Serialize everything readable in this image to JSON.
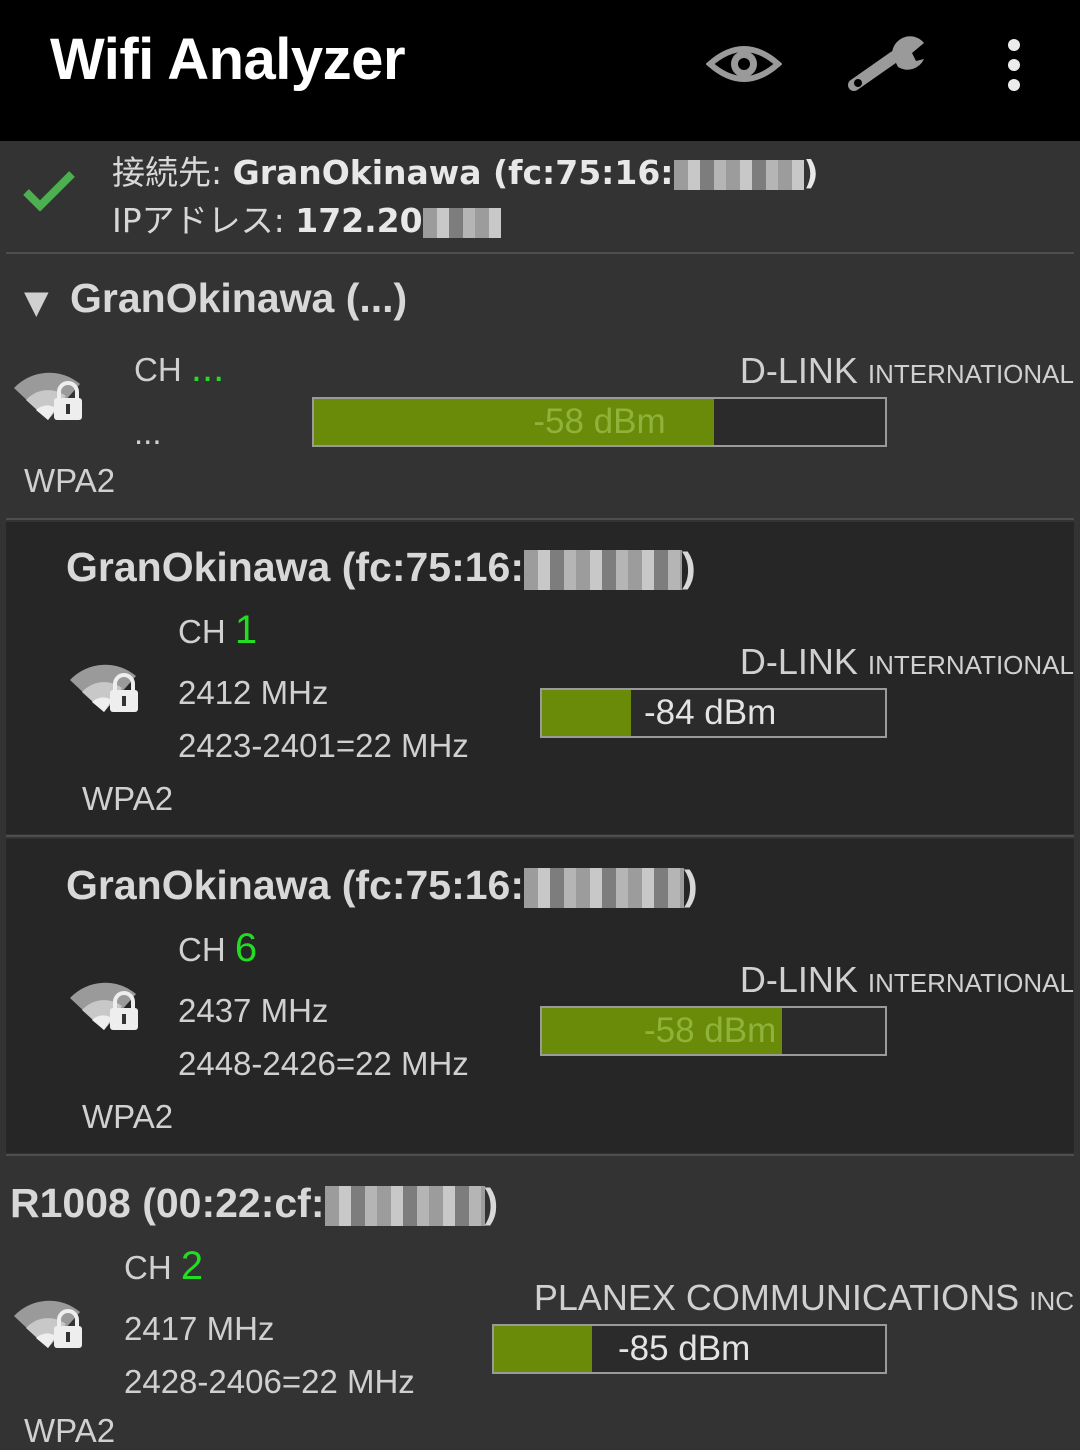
{
  "appbar": {
    "title": "Wifi Analyzer",
    "icons": [
      "eye-icon",
      "wrench-icon",
      "overflow-menu-icon"
    ]
  },
  "connection": {
    "label_connected": "接続先: ",
    "ssid_prefix": "GranOkinawa (fc:75:16:",
    "ssid_suffix": ")",
    "label_ip": "IPアドレス: ",
    "ip_prefix": "172.20"
  },
  "group": {
    "title": "GranOkinawa (...)",
    "ch_label": "CH",
    "ch_value": "...",
    "freq": "...",
    "vendor_main": "D-LINK",
    "vendor_sub": "INTERNATIONAL",
    "signal": "-58 dBm",
    "signal_fraction": 0.7,
    "security": "WPA2"
  },
  "networks": [
    {
      "ssid_prefix": "GranOkinawa (fc:75:16:",
      "ssid_suffix": ")",
      "ch_label": "CH",
      "channel": "1",
      "freq": "2412 MHz",
      "range": "2423-2401=22 MHz",
      "vendor_main": "D-LINK",
      "vendor_sub": "INTERNATIONAL",
      "signal": "-84 dBm",
      "signal_fraction": 0.26,
      "security": "WPA2"
    },
    {
      "ssid_prefix": "GranOkinawa (fc:75:16:",
      "ssid_suffix": ")",
      "ch_label": "CH",
      "channel": "6",
      "freq": "2437 MHz",
      "range": "2448-2426=22 MHz",
      "vendor_main": "D-LINK",
      "vendor_sub": "INTERNATIONAL",
      "signal": "-58 dBm",
      "signal_fraction": 0.7,
      "security": "WPA2"
    },
    {
      "ssid_prefix": "R1008 (00:22:cf:",
      "ssid_suffix": ")",
      "ch_label": "CH",
      "channel": "2",
      "freq": "2417 MHz",
      "range": "2428-2406=22 MHz",
      "vendor_main": "PLANEX COMMUNICATIONS",
      "vendor_sub": "INC",
      "signal": "-85 dBm",
      "signal_fraction": 0.25,
      "security": "WPA2"
    }
  ],
  "colors": {
    "appbar_bg": "#000000",
    "bg": "#333333",
    "sub_bg": "#262626",
    "signal_fill": "#6a8a0a",
    "channel_green": "#22dd22",
    "check_green": "#4caf50"
  }
}
